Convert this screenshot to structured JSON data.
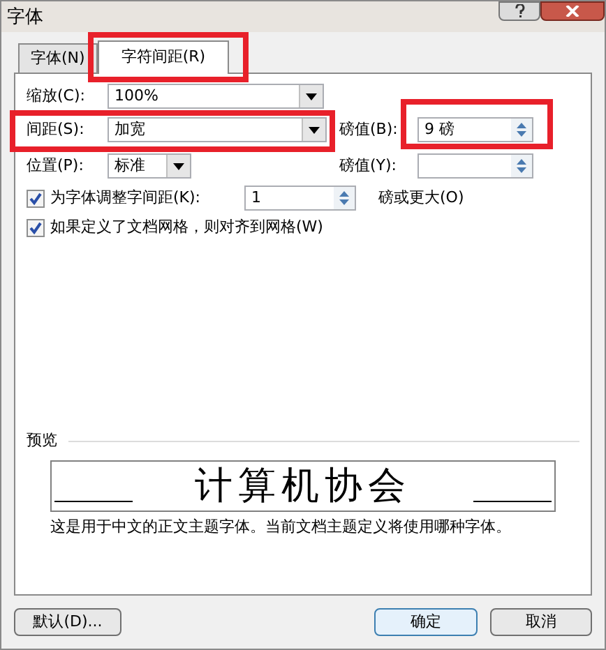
{
  "window": {
    "title": "字体"
  },
  "tabs": [
    {
      "label": "字体(N)",
      "selected": false
    },
    {
      "label": "字符间距(R)",
      "selected": true
    }
  ],
  "fields": {
    "scale": {
      "label": "缩放(C):",
      "value": "100%"
    },
    "spacing": {
      "label": "间距(S):",
      "value": "加宽"
    },
    "spacing_pt": {
      "label": "磅值(B):",
      "value": "9 磅"
    },
    "position": {
      "label": "位置(P):",
      "value": "标准"
    },
    "position_pt": {
      "label": "磅值(Y):"
    }
  },
  "kerning": {
    "label": "为字体调整字间距(K):",
    "checked": true,
    "value": "1",
    "suffix": "磅或更大(O)"
  },
  "grid": {
    "label": "如果定义了文档网格，则对齐到网格(W)",
    "checked": true
  },
  "preview": {
    "label": "预览",
    "sample": "计算机协会",
    "note": "这是用于中文的正文主题字体。当前文档主题定义将使用哪种字体。"
  },
  "buttons": {
    "default": "默认(D)...",
    "ok": "确定",
    "cancel": "取消"
  }
}
